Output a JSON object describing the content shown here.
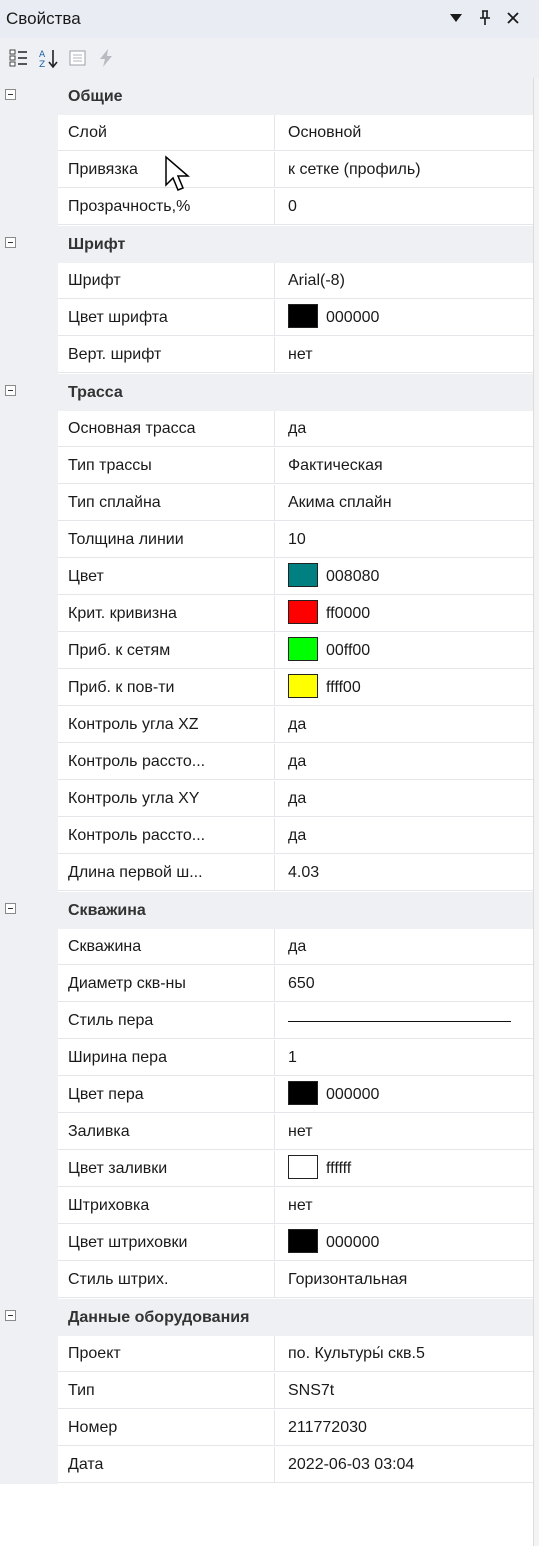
{
  "panel": {
    "title": "Свойства",
    "buttons": {
      "dropdown_icon": "dropdown-triangle-icon",
      "pin_icon": "pin-icon",
      "close_icon": "close-icon"
    }
  },
  "toolbar": {
    "tools": [
      "categorized-icon",
      "alphabetical-sort-icon",
      "property-pages-icon",
      "events-lightning-icon"
    ]
  },
  "colors": {
    "black": "#000000",
    "teal": "#008080",
    "red": "#ff0000",
    "green": "#00ff00",
    "yellow": "#ffff00",
    "white": "#ffffff"
  },
  "groups": [
    {
      "label": "Общие",
      "props": [
        {
          "name": "Слой",
          "value": "Основной"
        },
        {
          "name": "Привязка",
          "value": "к сетке (профиль)"
        },
        {
          "name": "Прозрачность,%",
          "value": "0"
        }
      ]
    },
    {
      "label": "Шрифт",
      "props": [
        {
          "name": "Шрифт",
          "value": "Arial(-8)"
        },
        {
          "name": "Цвет шрифта",
          "value": "000000",
          "swatch": "#000000"
        },
        {
          "name": "Верт. шрифт",
          "value": "нет"
        }
      ]
    },
    {
      "label": "Трасса",
      "props": [
        {
          "name": "Основная трасса",
          "value": "да"
        },
        {
          "name": "Тип трассы",
          "value": "Фактическая"
        },
        {
          "name": "Тип сплайна",
          "value": "Акима сплайн"
        },
        {
          "name": "Толщина линии",
          "value": "10"
        },
        {
          "name": "Цвет",
          "value": "008080",
          "swatch": "#008080"
        },
        {
          "name": "Крит. кривизна",
          "value": "ff0000",
          "swatch": "#ff0000"
        },
        {
          "name": "Приб. к сетям",
          "value": "00ff00",
          "swatch": "#00ff00"
        },
        {
          "name": "Приб. к пов-ти",
          "value": "ffff00",
          "swatch": "#ffff00"
        },
        {
          "name": "Контроль угла XZ",
          "value": "да"
        },
        {
          "name": "Контроль рассто...",
          "value": "да"
        },
        {
          "name": "Контроль угла XY",
          "value": "да"
        },
        {
          "name": "Контроль рассто...",
          "value": "да"
        },
        {
          "name": "Длина первой ш...",
          "value": "4.03"
        }
      ]
    },
    {
      "label": "Скважина",
      "props": [
        {
          "name": "Скважина",
          "value": "да"
        },
        {
          "name": "Диаметр скв-ны",
          "value": "650"
        },
        {
          "name": "Стиль пера",
          "value": "",
          "line": true
        },
        {
          "name": "Ширина пера",
          "value": "1"
        },
        {
          "name": "Цвет пера",
          "value": "000000",
          "swatch": "#000000"
        },
        {
          "name": "Заливка",
          "value": "нет"
        },
        {
          "name": "Цвет заливки",
          "value": "ffffff",
          "swatch": "#ffffff"
        },
        {
          "name": "Штриховка",
          "value": "нет"
        },
        {
          "name": "Цвет штриховки",
          "value": "000000",
          "swatch": "#000000"
        },
        {
          "name": "Стиль штрих.",
          "value": "Горизонтальная"
        }
      ]
    },
    {
      "label": "Данные оборудования",
      "props": [
        {
          "name": "Проект",
          "value": "по. Культуры́ скв.5"
        },
        {
          "name": "Тип",
          "value": "SNS7t"
        },
        {
          "name": "Номер",
          "value": " 211772030"
        },
        {
          "name": "Дата",
          "value": "2022-06-03 03:04"
        }
      ]
    }
  ]
}
